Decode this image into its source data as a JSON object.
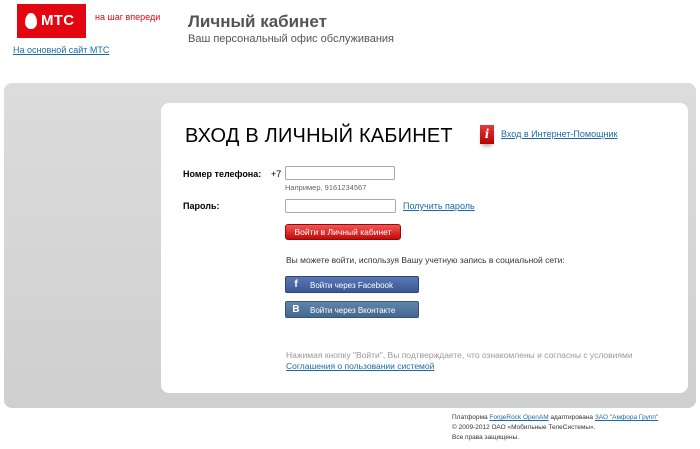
{
  "header": {
    "logo_text": "МТС",
    "slogan": "на шаг впереди",
    "main_site_link": "На основной сайт МТС",
    "title": "Личный кабинет",
    "subtitle": "Ваш персональный офис обслуживания"
  },
  "login": {
    "title": "ВХОД В ЛИЧНЫЙ КАБИНЕТ",
    "help_icon_glyph": "i",
    "help_link": "Вход в Интернет-Помощник",
    "phone_label": "Номер телефона:",
    "phone_prefix": "+7",
    "phone_value": "",
    "phone_hint": "Например, 9161234567",
    "password_label": "Пароль:",
    "password_value": "",
    "get_password_link": "Получить пароль",
    "login_button": "Войти в Личный кабинет",
    "social_text": "Вы можете войти, используя Вашу учетную запись в социальной сети:",
    "facebook_glyph": "f",
    "facebook_button": "Войти через Facebook",
    "vk_glyph": "B",
    "vk_button": "Войти через Вконтакте",
    "agree_text": "Нажимая кнопку \"Войти\", Вы подтверждаете, что ознакомлены и согласны с условиями",
    "agree_link": "Соглашения о пользовании системой"
  },
  "footer": {
    "platform_prefix": "Платформа ",
    "platform_link": "ForgeRock OpenAM",
    "platform_middle": " адаптирована ",
    "company_link": "ЗАО \"Амфора Групп\"",
    "copyright": "© 2009-2012 ОАО «Мобильные ТелеСистемы».",
    "rights": "Все права защищены."
  },
  "colors": {
    "brand_red": "#e30611",
    "link_blue": "#1b6aa5",
    "facebook_blue": "#3b5998",
    "vk_blue": "#45688e"
  }
}
